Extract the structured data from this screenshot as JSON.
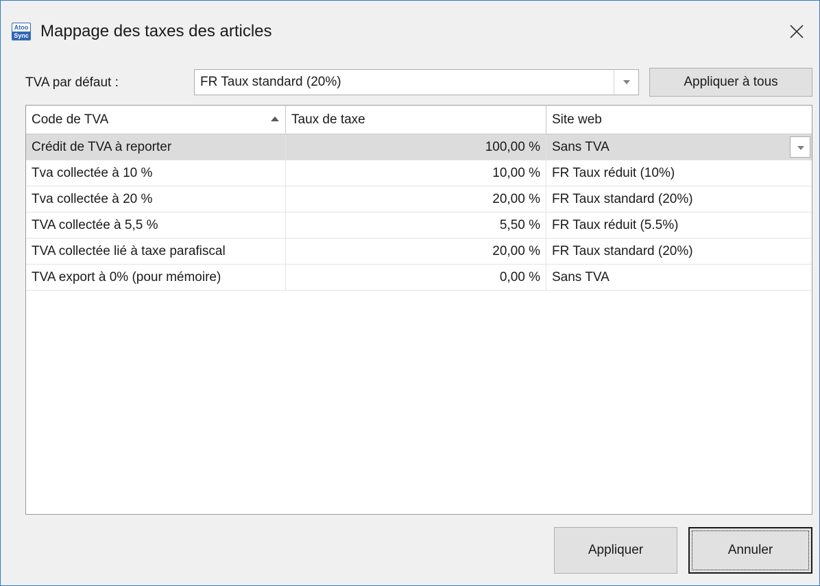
{
  "window": {
    "title": "Mappage des taxes des articles",
    "icon_name": "atoo-sync-app-icon",
    "icon_text_top": "Atoo",
    "icon_text_bottom": "Sync",
    "close_icon": "close-icon",
    "accent_color": "#2b79d0"
  },
  "default_tax": {
    "label": "TVA par défaut :",
    "selected": "FR Taux standard (20%)",
    "apply_all_label": "Appliquer à tous"
  },
  "grid": {
    "columns": [
      {
        "label": "Code de TVA",
        "sorted": "ascending"
      },
      {
        "label": "Taux de taxe"
      },
      {
        "label": "Site web"
      }
    ],
    "rows": [
      {
        "code": "Crédit de TVA à reporter",
        "rate": "100,00 %",
        "site": "Sans TVA",
        "selected": true
      },
      {
        "code": "Tva collectée à 10 %",
        "rate": "10,00 %",
        "site": "FR Taux réduit (10%)"
      },
      {
        "code": "Tva collectée à 20 %",
        "rate": "20,00 %",
        "site": "FR Taux standard (20%)"
      },
      {
        "code": "TVA collectée à 5,5 %",
        "rate": "5,50 %",
        "site": "FR Taux réduit (5.5%)"
      },
      {
        "code": "TVA collectée lié à taxe parafiscal",
        "rate": "20,00 %",
        "site": "FR Taux standard (20%)"
      },
      {
        "code": "TVA export à 0% (pour mémoire)",
        "rate": "0,00 %",
        "site": "Sans TVA"
      }
    ],
    "selected_row_color": "#dcdcdc"
  },
  "buttons": {
    "apply_label": "Appliquer",
    "cancel_label": "Annuler"
  }
}
